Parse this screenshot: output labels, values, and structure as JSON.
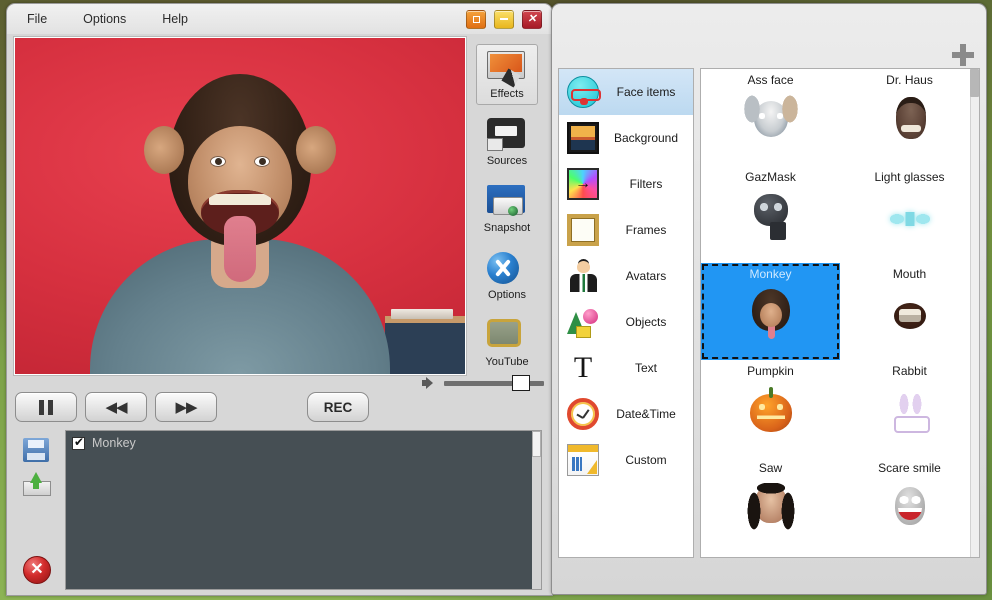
{
  "app": {
    "menu": [
      {
        "label": "File",
        "name": "menu-file"
      },
      {
        "label": "Options",
        "name": "menu-options"
      },
      {
        "label": "Help",
        "name": "menu-help"
      }
    ],
    "window_buttons": {
      "restore": "restore-icon",
      "minimize": "minimize-icon",
      "close": "close-icon",
      "close_glyph": "✕"
    }
  },
  "toolbar": {
    "items": [
      {
        "label": "Effects",
        "icon": "effects-icon",
        "active": true
      },
      {
        "label": "Sources",
        "icon": "sources-icon",
        "active": false
      },
      {
        "label": "Snapshot",
        "icon": "snapshot-icon",
        "active": false
      },
      {
        "label": "Options",
        "icon": "options-icon",
        "active": false
      },
      {
        "label": "YouTube",
        "icon": "youtube-icon",
        "active": false
      }
    ]
  },
  "transport": {
    "pause_label": "",
    "rewind_label": "◀◀",
    "forward_label": "▶▶",
    "record_label": "REC",
    "volume_icon": "speaker-icon",
    "volume_percent": 68
  },
  "effects_list": {
    "save_icon": "save-icon",
    "load_icon": "load-icon",
    "remove_icon": "remove-icon",
    "remove_glyph": "✕",
    "rows": [
      {
        "label": "Monkey",
        "checked": true
      }
    ]
  },
  "browser": {
    "add_button": "plus-icon",
    "categories": [
      {
        "label": "Face items",
        "icon": "face-items-icon",
        "active": true
      },
      {
        "label": "Background",
        "icon": "background-icon",
        "active": false
      },
      {
        "label": "Filters",
        "icon": "filters-icon",
        "active": false
      },
      {
        "label": "Frames",
        "icon": "frames-icon",
        "active": false
      },
      {
        "label": "Avatars",
        "icon": "avatars-icon",
        "active": false
      },
      {
        "label": "Objects",
        "icon": "objects-icon",
        "active": false
      },
      {
        "label": "Text",
        "icon": "text-icon",
        "glyph": "T",
        "active": false
      },
      {
        "label": "Date&Time",
        "icon": "date-time-icon",
        "active": false
      },
      {
        "label": "Custom",
        "icon": "custom-icon",
        "active": false
      }
    ],
    "effects": [
      {
        "label": "Ass face",
        "art": "assface",
        "selected": false
      },
      {
        "label": "Dr. Haus",
        "art": "drhaus",
        "selected": false
      },
      {
        "label": "GazMask",
        "art": "gazmask",
        "selected": false
      },
      {
        "label": "Light glasses",
        "art": "lightglasses",
        "selected": false
      },
      {
        "label": "Monkey",
        "art": "monkey",
        "selected": true
      },
      {
        "label": "Mouth",
        "art": "mouth",
        "selected": false
      },
      {
        "label": "Pumpkin",
        "art": "pumpkin",
        "selected": false
      },
      {
        "label": "Rabbit",
        "art": "rabbit",
        "selected": false
      },
      {
        "label": "Saw",
        "art": "saw",
        "selected": false
      },
      {
        "label": "Scare smile",
        "art": "scaresmile",
        "selected": false
      }
    ]
  },
  "colors": {
    "selection_blue": "#2196f3",
    "list_background": "#464f54",
    "close_red": "#a61a26",
    "minimize_yellow": "#e8b61d",
    "restore_orange": "#e06f13",
    "desktop_green": "#7ea349"
  }
}
